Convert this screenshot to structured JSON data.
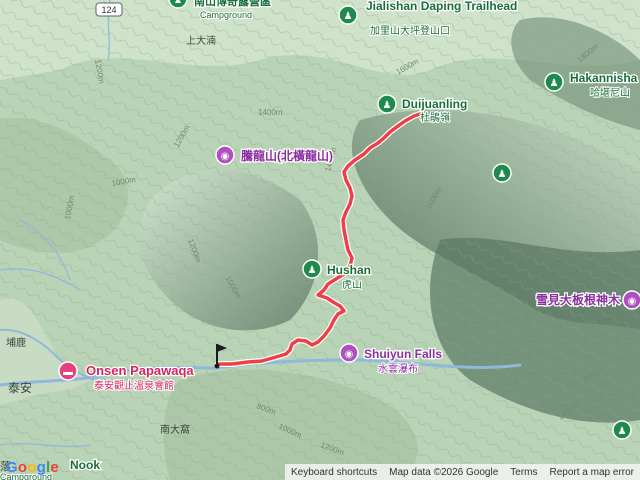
{
  "colors": {
    "terrain_base": "#b9d3b6",
    "route": "#ef3f46",
    "route_halo": "#ffffff",
    "park_pin": "#1e8a4c",
    "attraction_pin": "#b04fc0",
    "lodging_pin": "#e3427a",
    "label_green": "#1a6e3c",
    "label_purple": "#8b2ea0",
    "label_pink": "#d4245f",
    "contour_label": "#6f8a6a",
    "river": "#8fb8dc"
  },
  "road_shield": {
    "number": "124"
  },
  "pois": [
    {
      "name": "南山博奇露營區",
      "sub": "Campground",
      "type": "park"
    },
    {
      "name": "Jialishan Daping Trailhead",
      "sub": "加里山大坪登山口",
      "type": "park"
    },
    {
      "name": "Hakannisha",
      "sub": "哈堪尼山",
      "type": "park"
    },
    {
      "name": "Duijuanling",
      "sub": "杜鵑嶺",
      "type": "park"
    },
    {
      "name": "騰龍山(北橫龍山)",
      "sub": "",
      "type": "attraction"
    },
    {
      "name": "Hushan",
      "sub": "虎山",
      "type": "park"
    },
    {
      "name": "Shuiyun Falls",
      "sub": "水雲瀑布",
      "type": "attraction"
    },
    {
      "name": "Onsen Papawaqa",
      "sub": "泰安觀止溫泉會館",
      "type": "lodging"
    },
    {
      "name": "雪見大板根神木",
      "sub": "",
      "type": "attraction"
    },
    {
      "name": "",
      "sub": "",
      "type": "park"
    },
    {
      "name": "",
      "sub": "",
      "type": "park"
    },
    {
      "name": "Nook",
      "sub": "Campground",
      "type": "park"
    }
  ],
  "place_labels": [
    "上大湳",
    "埔鹿",
    "泰安",
    "南大窩",
    "落"
  ],
  "contour_labels": [
    "1400m",
    "1600m",
    "1200m",
    "1000m",
    "1000m",
    "1800m",
    "1400m",
    "1200m",
    "1000m",
    "800m",
    "800m",
    "1000m",
    "1200m",
    "1400m",
    "1200m",
    "1000m"
  ],
  "route": {
    "start_marker": "start-flag"
  },
  "attribution": {
    "logo": "Google",
    "keyboard": "Keyboard shortcuts",
    "map_data": "Map data ©2026 Google",
    "terms": "Terms",
    "report": "Report a map error"
  }
}
